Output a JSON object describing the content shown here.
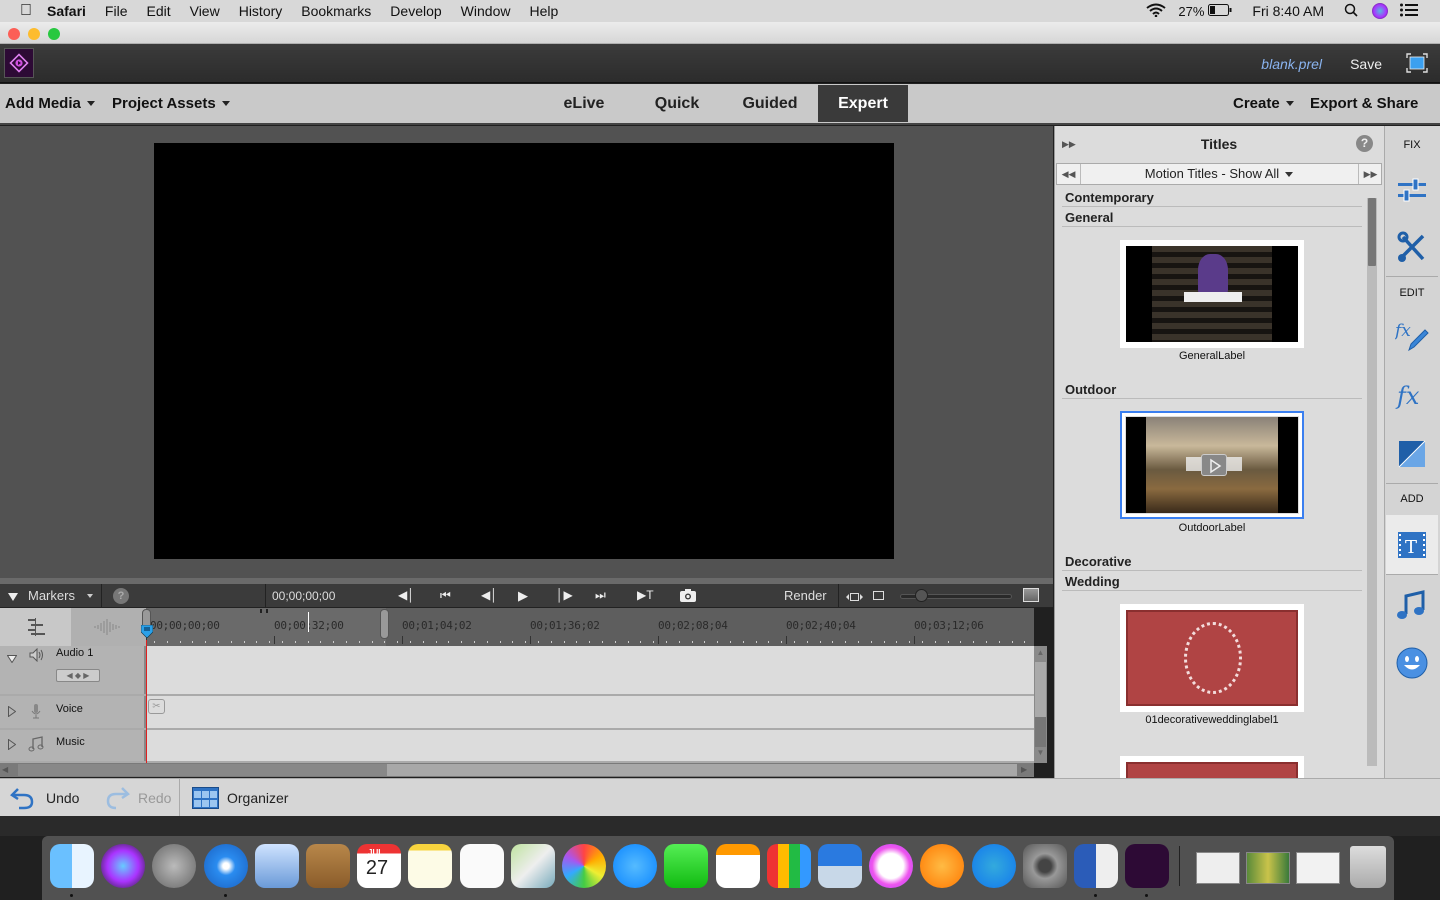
{
  "menubar": {
    "app": "Safari",
    "items": [
      "File",
      "Edit",
      "View",
      "History",
      "Bookmarks",
      "Develop",
      "Window",
      "Help"
    ],
    "battery": "27%",
    "clock": "Fri 8:40 AM"
  },
  "appbar": {
    "filename": "blank.prel",
    "save_label": "Save"
  },
  "nav": {
    "add_media": "Add Media",
    "project_assets": "Project Assets",
    "tabs": [
      {
        "label": "eLive",
        "active": false
      },
      {
        "label": "Quick",
        "active": false
      },
      {
        "label": "Guided",
        "active": false
      },
      {
        "label": "Expert",
        "active": true
      }
    ],
    "create": "Create",
    "export_share": "Export & Share"
  },
  "timeline": {
    "markers_label": "Markers",
    "current_time": "00;00;00;00",
    "render_label": "Render",
    "zoom_level": 0.15,
    "ruler_ticks": [
      "00;00;00;00",
      "00;00;32;00",
      "00;01;04;02",
      "00;01;36;02",
      "00;02;08;04",
      "00;02;40;04",
      "00;03;12;06"
    ],
    "tracks": [
      {
        "name": "Audio 1",
        "icon": "speaker-icon",
        "expanded": true
      },
      {
        "name": "Voice",
        "icon": "microphone-icon",
        "expanded": false
      },
      {
        "name": "Music",
        "icon": "music-note-icon",
        "expanded": false
      }
    ]
  },
  "bottombar": {
    "undo": "Undo",
    "redo": "Redo",
    "organizer": "Organizer"
  },
  "panel": {
    "title": "Titles",
    "filter": "Motion Titles - Show All",
    "categories": [
      {
        "name": "Contemporary",
        "items": []
      },
      {
        "name": "General",
        "items": [
          {
            "label": "GeneralLabel",
            "selected": false
          }
        ]
      },
      {
        "name": "Outdoor",
        "items": [
          {
            "label": "OutdoorLabel",
            "selected": true
          }
        ]
      },
      {
        "name": "Decorative",
        "items": []
      },
      {
        "name": "Wedding",
        "items": [
          {
            "label": "01decorativeweddinglabel1",
            "selected": false
          }
        ]
      }
    ]
  },
  "sidebar": {
    "fix": "FIX",
    "edit": "EDIT",
    "add": "ADD",
    "icons": [
      "adjust-sliders-icon",
      "tools-icon",
      "fx-edit-icon",
      "fx-icon",
      "transition-icon",
      "titles-icon",
      "music-icon",
      "graphics-smiley-icon"
    ]
  },
  "dock": {
    "apps": [
      "Finder",
      "Siri",
      "Launchpad",
      "Safari",
      "Mail",
      "Contacts",
      "Calendar",
      "Notes",
      "Reminders",
      "Maps",
      "Photos",
      "Messages",
      "FaceTime",
      "Pages",
      "Numbers",
      "Keynote",
      "iTunes",
      "iBooks",
      "App Store",
      "System Preferences",
      "Microsoft Word",
      "Premiere Elements"
    ],
    "calendar_month": "JUL",
    "calendar_day": "27"
  },
  "colors": {
    "accent": "#3a7ff0",
    "app_dark": "#3a3a3a",
    "icon_blue": "#2f73c4",
    "playhead": "#e02020"
  }
}
